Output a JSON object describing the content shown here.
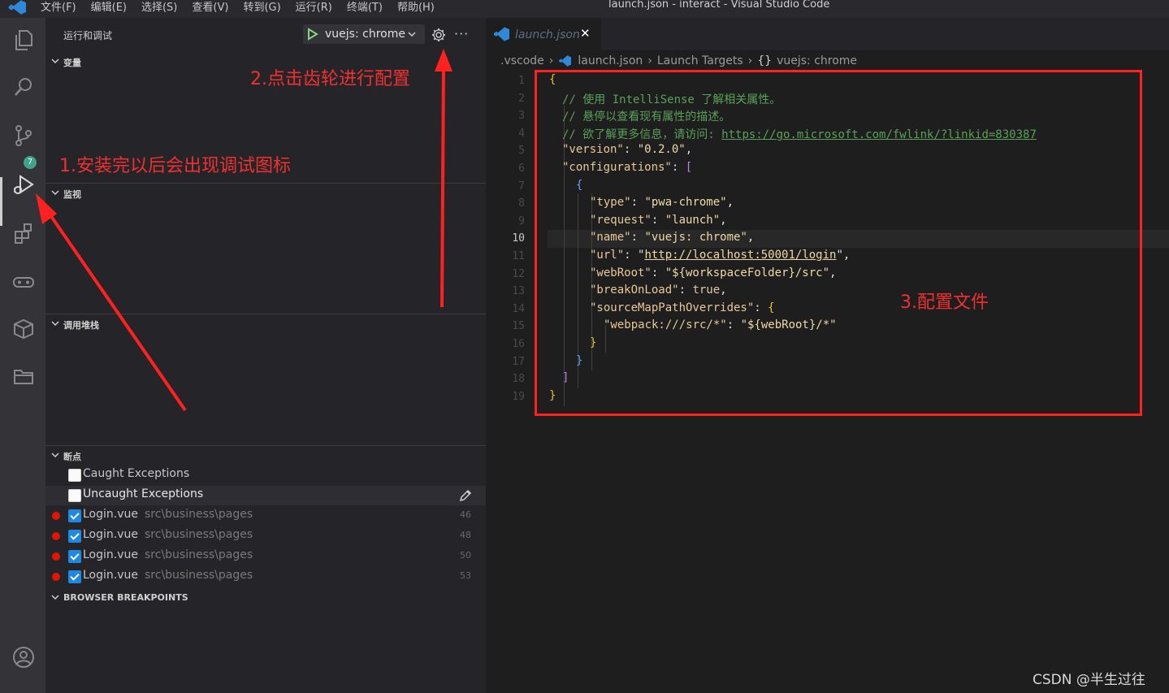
{
  "titlebar": {
    "menu": [
      "文件(F)",
      "编辑(E)",
      "选择(S)",
      "查看(V)",
      "转到(G)",
      "运行(R)",
      "终端(T)",
      "帮助(H)"
    ],
    "window_title": "launch.json - interact - Visual Studio Code"
  },
  "activity_bar": {
    "items": [
      "explorer-icon",
      "search-icon",
      "source-control-icon",
      "run-debug-icon",
      "extensions-icon",
      "remote-icon",
      "packages-icon",
      "folder-icon",
      "account-icon"
    ],
    "scm_badge": "7"
  },
  "sidebar": {
    "title": "运行和调试",
    "run_config_label": "vuejs: chrome",
    "sections": {
      "variables": "变量",
      "watch": "监视",
      "call_stack": "调用堆栈",
      "breakpoints": "断点",
      "browser_breakpoints": "BROWSER BREAKPOINTS"
    },
    "exceptions": [
      {
        "label": "Caught Exceptions",
        "checked": false
      },
      {
        "label": "Uncaught Exceptions",
        "checked": false
      }
    ],
    "breakpoints": [
      {
        "file": "Login.vue",
        "path": "src\\business\\pages",
        "line": "46"
      },
      {
        "file": "Login.vue",
        "path": "src\\business\\pages",
        "line": "48"
      },
      {
        "file": "Login.vue",
        "path": "src\\business\\pages",
        "line": "50"
      },
      {
        "file": "Login.vue",
        "path": "src\\business\\pages",
        "line": "53"
      }
    ]
  },
  "editor": {
    "tab_label": "launch.json",
    "breadcrumb": [
      ".vscode",
      "launch.json",
      "Launch Targets",
      "vuejs: chrome"
    ],
    "current_line": 10,
    "code": {
      "l2": "// 使用 IntelliSense 了解相关属性。",
      "l3": "// 悬停以查看现有属性的描述。",
      "l4_text": "// 欲了解更多信息，请访问: ",
      "l4_link": "https://go.microsoft.com/fwlink/?linkid=830387",
      "version_key": "\"version\"",
      "version_val": "\"0.2.0\"",
      "configurations_key": "\"configurations\"",
      "type_key": "\"type\"",
      "type_val": "\"pwa-chrome\"",
      "request_key": "\"request\"",
      "request_val": "\"launch\"",
      "name_key": "\"name\"",
      "name_val": "\"vuejs: chrome\"",
      "url_key": "\"url\"",
      "url_val": "http://localhost:50001/login",
      "webroot_key": "\"webRoot\"",
      "webroot_val": "\"${workspaceFolder}/src\"",
      "breakonload_key": "\"breakOnLoad\"",
      "breakonload_val": "true",
      "smpo_key": "\"sourceMapPathOverrides\"",
      "webpack_key": "\"webpack:///src/*\"",
      "webpack_val": "\"${webRoot}/*\""
    }
  },
  "annotations": {
    "step1": "1.安装完以后会出现调试图标",
    "step2": "2.点击齿轮进行配置",
    "step3": "3.配置文件",
    "color": "#f03030"
  },
  "watermark": "CSDN @半生过往"
}
